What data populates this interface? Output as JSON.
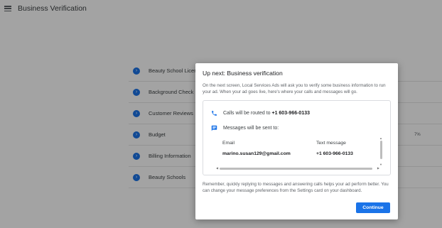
{
  "app": {
    "title": "Business Verification",
    "menu_icon": "menu-icon"
  },
  "steps": [
    {
      "label": "Beauty School License",
      "icon": "step-dot-icon"
    },
    {
      "label": "Background Check",
      "icon": "step-dot-icon"
    },
    {
      "label": "Customer Reviews",
      "icon": "step-dot-icon"
    },
    {
      "label": "Budget",
      "icon": "step-dot-icon"
    },
    {
      "label": "Billing Information",
      "icon": "step-dot-icon"
    },
    {
      "label": "Beauty Schools",
      "icon": "step-dot-icon"
    }
  ],
  "side_value": "7%",
  "dialog": {
    "title": "Up next: Business verification",
    "description": "On the next screen, Local Services Ads will ask you to verify some business information to run your ad. When your ad goes live, here's where your calls and messages will go.",
    "calls_prefix": "Calls will be routed to ",
    "calls_number": "+1 603-966-0133",
    "messages_label": "Messages will be sent to:",
    "table": {
      "headers": [
        "Email",
        "Text message"
      ],
      "row": [
        "marino.susan129@gmail.com",
        "+1 603-966-0133"
      ]
    },
    "note": "Remember, quickly replying to messages and answering calls helps your ad perform better. You can change your message preferences from the Settings card on your dashboard.",
    "continue_label": "Continue"
  },
  "colors": {
    "accent": "#1a73e8",
    "overlay": "rgba(0,0,0,0.36)"
  }
}
